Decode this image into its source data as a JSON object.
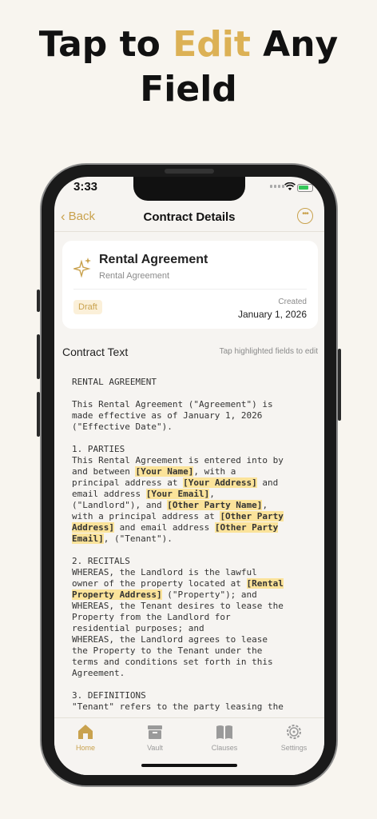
{
  "headline": {
    "part1": "Tap to ",
    "accent": "Edit",
    "part2": " Any",
    "line2": "Field",
    "accent_color": "#dcb155"
  },
  "status_bar": {
    "time": "3:33"
  },
  "nav": {
    "back_label": "Back",
    "title": "Contract Details"
  },
  "card": {
    "title": "Rental Agreement",
    "subtitle": "Rental Agreement",
    "badge": "Draft",
    "created_label": "Created",
    "created_date": "January 1, 2026"
  },
  "section": {
    "title": "Contract Text",
    "hint": "Tap highlighted fields to edit"
  },
  "doc": {
    "p0": "RENTAL AGREEMENT\n\nThis Rental Agreement (\"Agreement\") is\nmade effective as of January 1, 2026\n(\"Effective Date\").\n\n1. PARTIES\nThis Rental Agreement is entered into by\nand between ",
    "f_name": "[Your Name]",
    "p1": ", with a\nprincipal address at ",
    "f_addr": "[Your Address]",
    "p2": " and\nemail address ",
    "f_email": "[Your Email]",
    "p3": ",\n(\"Landlord\"), and ",
    "f_oname": "[Other Party Name]",
    "p4": ",\nwith a principal address at ",
    "f_oaddr": "[Other Party\nAddress]",
    "p5": " and email address ",
    "f_oemail": "[Other Party\nEmail]",
    "p6": ", (\"Tenant\").\n\n2. RECITALS\nWHEREAS, the Landlord is the lawful\nowner of the property located at ",
    "f_prop": "[Rental\nProperty Address]",
    "p7": " (\"Property\"); and\nWHEREAS, the Tenant desires to lease the\nProperty from the Landlord for\nresidential purposes; and\nWHEREAS, the Landlord agrees to lease\nthe Property to the Tenant under the\nterms and conditions set forth in this\nAgreement.\n\n3. DEFINITIONS\n\"Tenant\" refers to the party leasing the"
  },
  "tabs": [
    {
      "label": "Home",
      "icon": "home-icon",
      "active": true
    },
    {
      "label": "Vault",
      "icon": "archive-icon",
      "active": false
    },
    {
      "label": "Clauses",
      "icon": "book-icon",
      "active": false
    },
    {
      "label": "Settings",
      "icon": "gear-icon",
      "active": false
    }
  ],
  "colors": {
    "accent": "#c9a24e",
    "highlight": "#fbe39a"
  }
}
